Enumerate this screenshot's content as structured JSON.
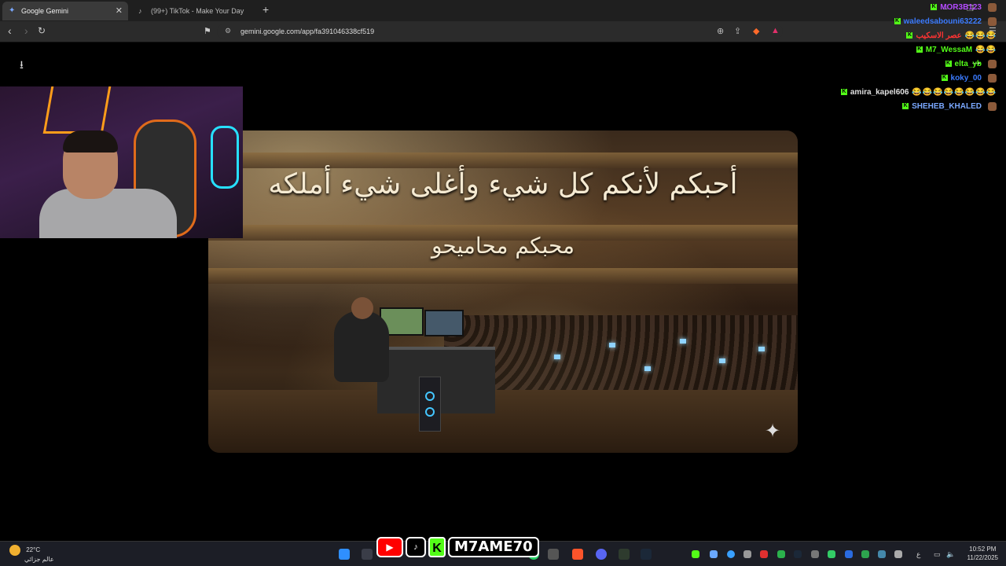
{
  "browser": {
    "tabs": [
      {
        "title": "Google Gemini",
        "active": true
      },
      {
        "title": "(99+) TikTok - Make Your Day",
        "active": false
      }
    ],
    "new_tab": "+",
    "url": "gemini.google.com/app/fa391046338cf519",
    "window_controls": [
      "–",
      "❐",
      "✕"
    ]
  },
  "image": {
    "calligraphy_line1": "أحبكم لأنكم كل شيء وأغلى شيء أملكه",
    "calligraphy_line2": "محبكم محاميحو"
  },
  "chat": [
    {
      "user": "MOR3B123",
      "color": "#b44bff",
      "emotes": ""
    },
    {
      "user": "waleedsabouni63222",
      "color": "#3b7bff",
      "emotes": ""
    },
    {
      "user": "عصر الاسكيب",
      "color": "#ff3333",
      "emotes": "😂😂😂"
    },
    {
      "user": "M7_WessaM",
      "color": "#53fc18",
      "emotes": "😂😂"
    },
    {
      "user": "elta_yb",
      "color": "#53fc18",
      "emotes": ""
    },
    {
      "user": "koky_00",
      "color": "#3b7bff",
      "emotes": ""
    },
    {
      "user": "amira_kapel606",
      "color": "#e0e0e0",
      "emotes": "😂😂😂😂😂😂😂😂"
    },
    {
      "user": "SHEHEB_KHALED",
      "color": "#7aa8ff",
      "emotes": ""
    }
  ],
  "taskbar": {
    "temperature": "22°C",
    "weather_label": "عالم جزائي",
    "brand_name": "M7AME70",
    "time": "10:52 PM",
    "date": "11/22/2025",
    "lang": "ع"
  },
  "colors": {
    "accent_kick": "#53fc18",
    "taskbar_bg": "#1c1e26",
    "browser_bg": "#2b2b2b"
  }
}
